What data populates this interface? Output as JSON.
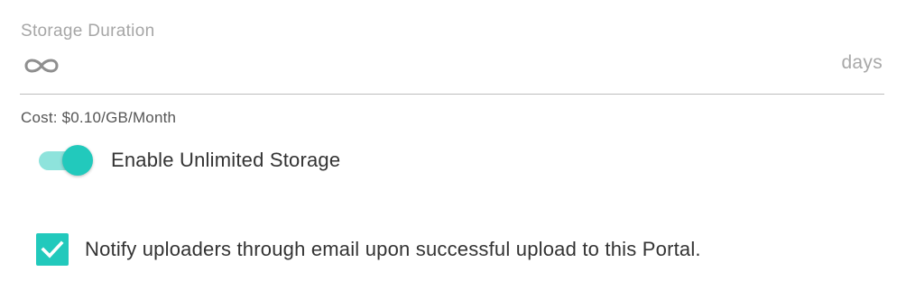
{
  "storage_duration": {
    "label": "Storage Duration",
    "value_icon": "infinity-icon",
    "value": "∞",
    "suffix": "days"
  },
  "cost_text": "Cost: $0.10/GB/Month",
  "unlimited_storage_toggle": {
    "label": "Enable Unlimited Storage",
    "enabled": true
  },
  "notify_checkbox": {
    "label": "Notify uploaders through email upon successful upload to this Portal.",
    "checked": true
  },
  "colors": {
    "accent": "#22c9bc",
    "accent_light": "#8ee3dc",
    "muted_text": "#a6a6a6",
    "body_text": "#333333"
  }
}
